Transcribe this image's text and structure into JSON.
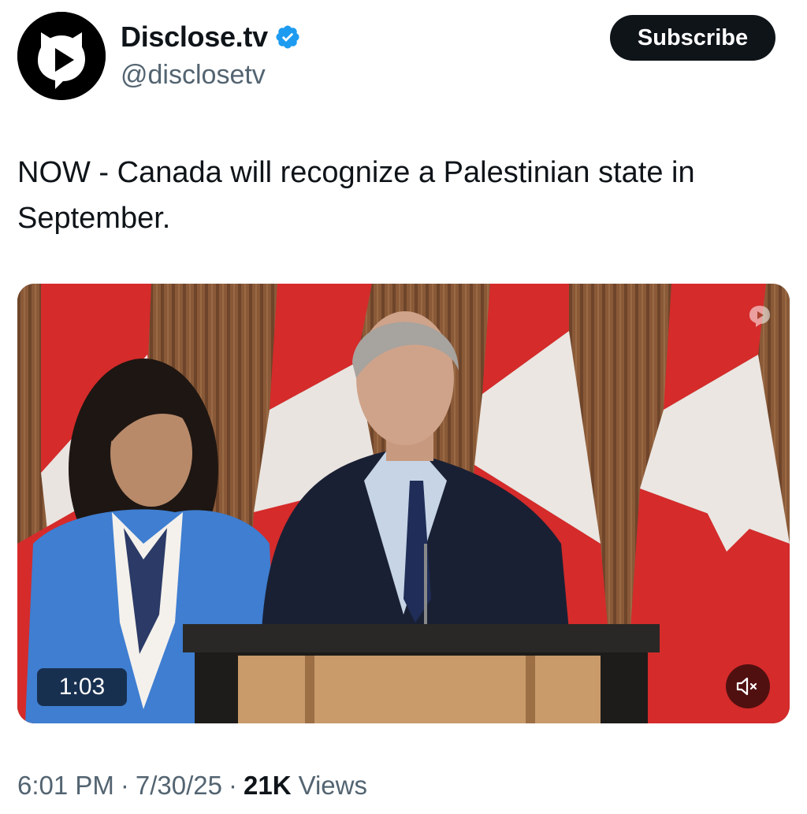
{
  "author": {
    "display_name": "Disclose.tv",
    "handle": "@disclosetv",
    "verified": true,
    "avatar_icon": "disclose-logo-icon"
  },
  "subscribe_label": "Subscribe",
  "tweet": {
    "text": "NOW - Canada will recognize a Palestinian state in September."
  },
  "media": {
    "duration": "1:03",
    "muted": true,
    "mute_icon": "speaker-muted-icon",
    "watermark_icon": "disclose-watermark-icon"
  },
  "meta": {
    "time": "6:01 PM",
    "separator": "·",
    "date": "7/30/25",
    "views_count": "21K",
    "views_label": "Views"
  },
  "colors": {
    "text_primary": "#0f1419",
    "text_secondary": "#536471",
    "verified_blue": "#1d9bf0",
    "button_bg": "#0f1419"
  }
}
